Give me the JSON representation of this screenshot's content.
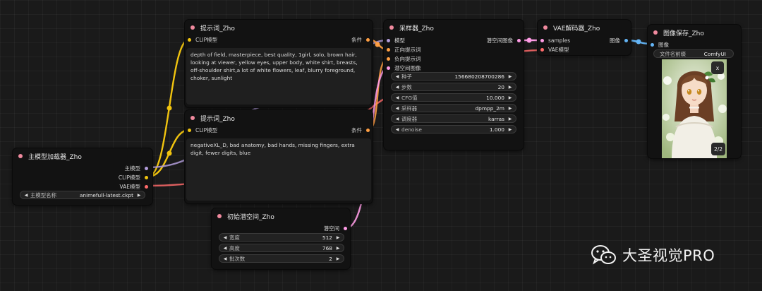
{
  "colors": {
    "clip": "#f1c40f",
    "conditioning": "#ff9f43",
    "model": "#b39ddb",
    "latent": "#ff9ce6",
    "vae": "#ff6b6b",
    "image": "#64b5f6",
    "title_dot": "#f08a9e"
  },
  "model_loader": {
    "title": "主模型加载器_Zho",
    "outputs": [
      "主模型",
      "CLIP模型",
      "VAE模型"
    ],
    "widget_label": "主模型名称",
    "widget_value": "animefull-latest.ckpt"
  },
  "prompt_pos": {
    "title": "提示词_Zho",
    "input": "CLIP模型",
    "output": "条件",
    "text": "depth of field, masterpiece, best quality, 1girl, solo, brown hair, looking at viewer, yellow eyes, upper body, white shirt, breasts, off-shoulder shirt,a lot of white flowers, leaf, blurry foreground, choker, sunlight"
  },
  "prompt_neg": {
    "title": "提示词_Zho",
    "input": "CLIP模型",
    "output": "条件",
    "text": "negativeXL_D, bad anatomy, bad hands, missing fingers, extra digit, fewer digits, blue"
  },
  "latent": {
    "title": "初始潜空间_Zho",
    "output": "潜空间",
    "widgets": [
      {
        "label": "宽度",
        "value": "512"
      },
      {
        "label": "高度",
        "value": "768"
      },
      {
        "label": "批次数",
        "value": "2"
      }
    ]
  },
  "sampler": {
    "title": "采样器_Zho",
    "inputs": [
      "模型",
      "正向提示词",
      "负向提示词",
      "潜空间图像"
    ],
    "output": "潜空间图像",
    "widgets": [
      {
        "label": "种子",
        "value": "156680208700286"
      },
      {
        "label": "步数",
        "value": "20"
      },
      {
        "label": "CFG值",
        "value": "10.000"
      },
      {
        "label": "采样器",
        "value": "dpmpp_2m"
      },
      {
        "label": "调度器",
        "value": "karras"
      },
      {
        "label": "denoise",
        "value": "1.000"
      }
    ]
  },
  "vae_decoder": {
    "title": "VAE解码器_Zho",
    "inputs": [
      "samples",
      "VAE模型"
    ],
    "output": "图像"
  },
  "image_save": {
    "title": "图像保存_Zho",
    "input": "图像",
    "widget_label": "文件名前缀",
    "widget_value": "ComfyUI",
    "close_label": "x",
    "counter": "2/2"
  },
  "watermark": {
    "text": "大圣视觉PRO"
  }
}
